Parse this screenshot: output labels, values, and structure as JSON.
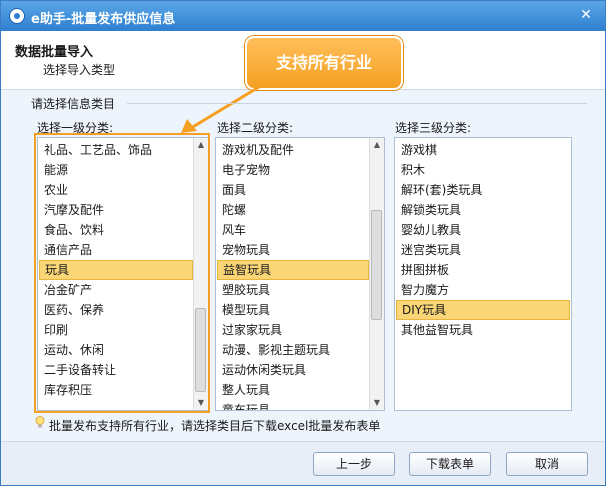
{
  "window": {
    "title": "e助手-批量发布供应信息",
    "close_glyph": "✕"
  },
  "header": {
    "title": "数据批量导入",
    "subtitle": "选择导入类型"
  },
  "callout": {
    "text": "支持所有行业"
  },
  "group_label": "请选择信息类目",
  "columns": [
    {
      "label": "选择一级分类:",
      "items": [
        "礼品、工艺品、饰品",
        "能源",
        "农业",
        "汽摩及配件",
        "食品、饮料",
        "通信产品",
        "玩具",
        "冶金矿产",
        "医药、保养",
        "印刷",
        "运动、休闲",
        "二手设备转让",
        "库存积压"
      ],
      "selected": "玩具"
    },
    {
      "label": "选择二级分类:",
      "items": [
        "游戏机及配件",
        "电子宠物",
        "面具",
        "陀螺",
        "风车",
        "宠物玩具",
        "益智玩具",
        "塑胶玩具",
        "模型玩具",
        "过家家玩具",
        "动漫、影视主题玩具",
        "运动休闲类玩具",
        "整人玩具",
        "童车玩具"
      ],
      "selected": "益智玩具"
    },
    {
      "label": "选择三级分类:",
      "items": [
        "游戏棋",
        "积木",
        "解环(套)类玩具",
        "解锁类玩具",
        "婴幼儿教具",
        "迷宫类玩具",
        "拼图拼板",
        "智力魔方",
        "DIY玩具",
        "其他益智玩具"
      ],
      "selected": "DIY玩具"
    }
  ],
  "tip": "批量发布支持所有行业，请选择类目后下载excel批量发布表单",
  "buttons": {
    "prev": "上一步",
    "download": "下载表单",
    "cancel": "取消"
  },
  "colors": {
    "accent_orange": "#f5a023",
    "title_blue": "#2f7fd0",
    "selected_bg": "#fad677"
  },
  "icons": [
    "app-icon",
    "close-icon",
    "lightbulb-icon",
    "scroll-up-icon",
    "scroll-down-icon"
  ]
}
